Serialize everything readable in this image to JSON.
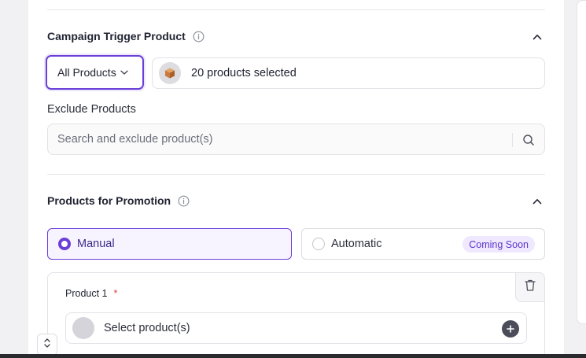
{
  "campaign_trigger": {
    "title": "Campaign Trigger Product",
    "dropdown_value": "All Products",
    "selected_summary": "20 products selected",
    "exclude_label": "Exclude Products",
    "exclude_placeholder": "Search and exclude product(s)"
  },
  "promotion": {
    "title": "Products for Promotion",
    "manual_label": "Manual",
    "automatic_label": "Automatic",
    "coming_soon_badge": "Coming Soon",
    "selected_mode": "Manual"
  },
  "product_card": {
    "label": "Product 1",
    "required_marker": "*",
    "select_placeholder": "Select product(s)"
  },
  "icons": {
    "info": "info-icon",
    "chevron_up": "chevron-up-icon",
    "chevron_down": "chevron-down-icon",
    "package": "package-icon",
    "search": "search-icon",
    "trash": "trash-icon",
    "plus": "plus-icon",
    "updown": "chevron-up-down-icon"
  },
  "colors": {
    "accent": "#6a3fd8",
    "badge_bg": "#efe8ff",
    "required": "#e03a3a"
  }
}
